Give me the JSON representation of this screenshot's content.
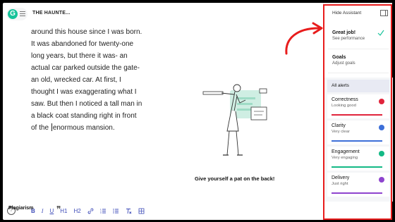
{
  "header": {
    "doc_title": "THE HAUNTE..."
  },
  "editor": {
    "lines": [
      "around this house since I was born.",
      "It was abandoned for twenty-one",
      "long years, but there it was- an",
      "actual car parked outside the gate-",
      "an old, wrecked car. At first, I",
      "thought I was exaggerating what I",
      "saw. But then I noticed a tall man in",
      "a black coat standing right in front"
    ],
    "last_line_before_caret": "of the ",
    "last_line_after_caret": "enormous mansion."
  },
  "illustration": {
    "caption": "Give yourself a pat on the back!"
  },
  "toolbar": {
    "help": "?",
    "bold": "B",
    "italic": "I",
    "underline": "U",
    "h1": "H1",
    "h2": "H2"
  },
  "assistant": {
    "hide_label": "Hide Assistant",
    "great_title": "Great job!",
    "great_sub": "See performance",
    "goals_title": "Goals",
    "goals_sub": "Adjust goals",
    "all_alerts": "All alerts",
    "alerts": [
      {
        "name": "Correctness",
        "state": "Looking good",
        "color": "#e0243b"
      },
      {
        "name": "Clarity",
        "state": "Very clear",
        "color": "#3d6fd8"
      },
      {
        "name": "Engagement",
        "state": "Very engaging",
        "color": "#13b985"
      },
      {
        "name": "Delivery",
        "state": "Just right",
        "color": "#8e44ce"
      }
    ],
    "plagiarism": "Plagiarism",
    "plagiarism_icon": "quote-icon"
  },
  "colors": {
    "brand": "#15c39a",
    "highlight_red": "#e81c1c",
    "toolbar_blue": "#3d4bb8"
  }
}
